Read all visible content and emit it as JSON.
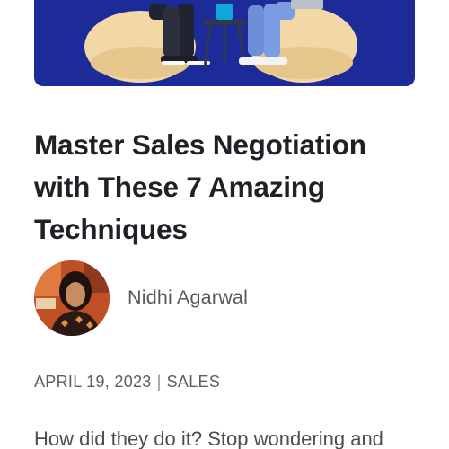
{
  "hero": {
    "image": "people-on-beanbags-illustration",
    "background_color": "#1c2b97"
  },
  "article": {
    "title_lines": [
      "Master Sales Negotiation",
      "with These 7 Amazing",
      "Techniques"
    ],
    "author": {
      "name": "Nidhi Agarwal",
      "avatar": "author-photo"
    },
    "date": "APRIL 19, 2023",
    "separator": "|",
    "category": "SALES",
    "excerpt": "How did they do it? Stop wondering and"
  }
}
